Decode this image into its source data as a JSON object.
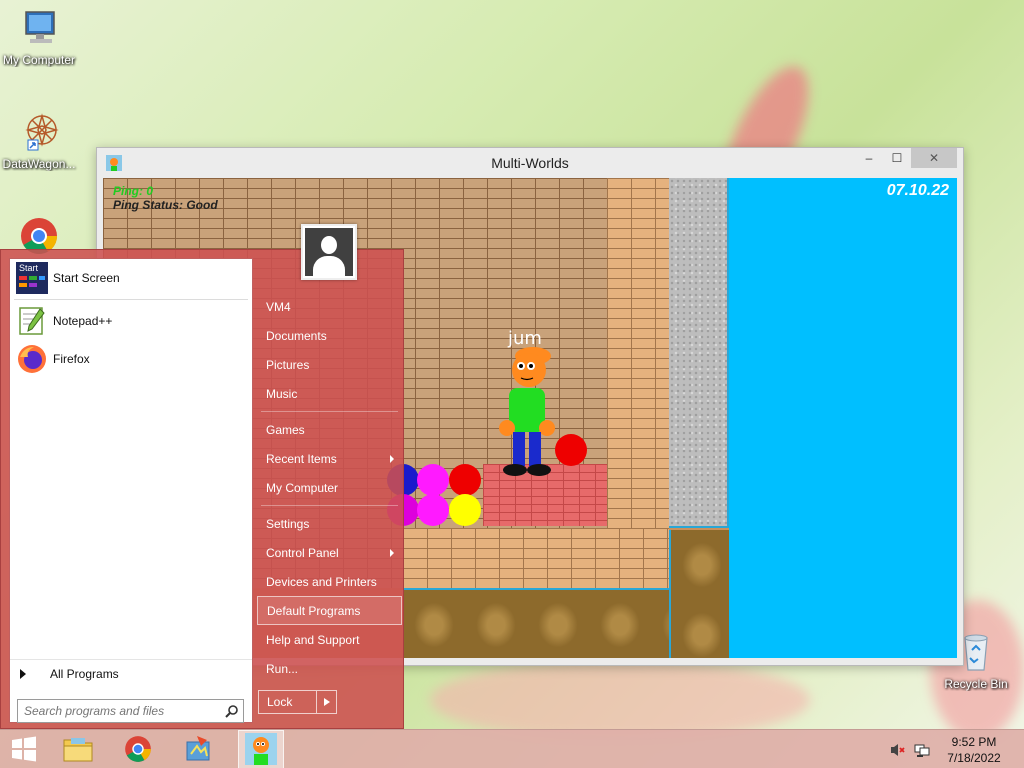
{
  "desktop": {
    "icons": [
      {
        "label": "My Computer"
      },
      {
        "label": "DataWagon..."
      },
      {
        "label": ""
      },
      {
        "label": "Recycle Bin"
      }
    ]
  },
  "window": {
    "title": "Multi-Worlds",
    "minimize_symbol": "–",
    "maximize_symbol": "☐",
    "close_symbol": "✕"
  },
  "game": {
    "ping_label": "Ping: 0",
    "ping_status": "Ping Status: Good",
    "date": "07.10.22",
    "player_name": "jum"
  },
  "start_menu": {
    "pinned": [
      {
        "label": "Start Screen"
      },
      {
        "label": "Notepad++"
      },
      {
        "label": "Firefox"
      }
    ],
    "all_programs": "All Programs",
    "search_placeholder": "Search programs and files",
    "right_items": [
      {
        "label": "VM4"
      },
      {
        "label": "Documents"
      },
      {
        "label": "Pictures"
      },
      {
        "label": "Music"
      },
      {
        "label": "Games"
      },
      {
        "label": "Recent Items"
      },
      {
        "label": "My Computer"
      },
      {
        "label": "Settings"
      },
      {
        "label": "Control Panel"
      },
      {
        "label": "Devices and Printers"
      },
      {
        "label": "Default Programs"
      },
      {
        "label": "Help and Support"
      },
      {
        "label": "Run..."
      }
    ],
    "lock_label": "Lock",
    "start_tile_text": "Start"
  },
  "taskbar": {
    "time": "9:52 PM",
    "date": "7/18/2022"
  },
  "colors": {
    "sky": "#00bfff",
    "start_menu": "#cd5050",
    "ping_green": "#22cc22"
  }
}
